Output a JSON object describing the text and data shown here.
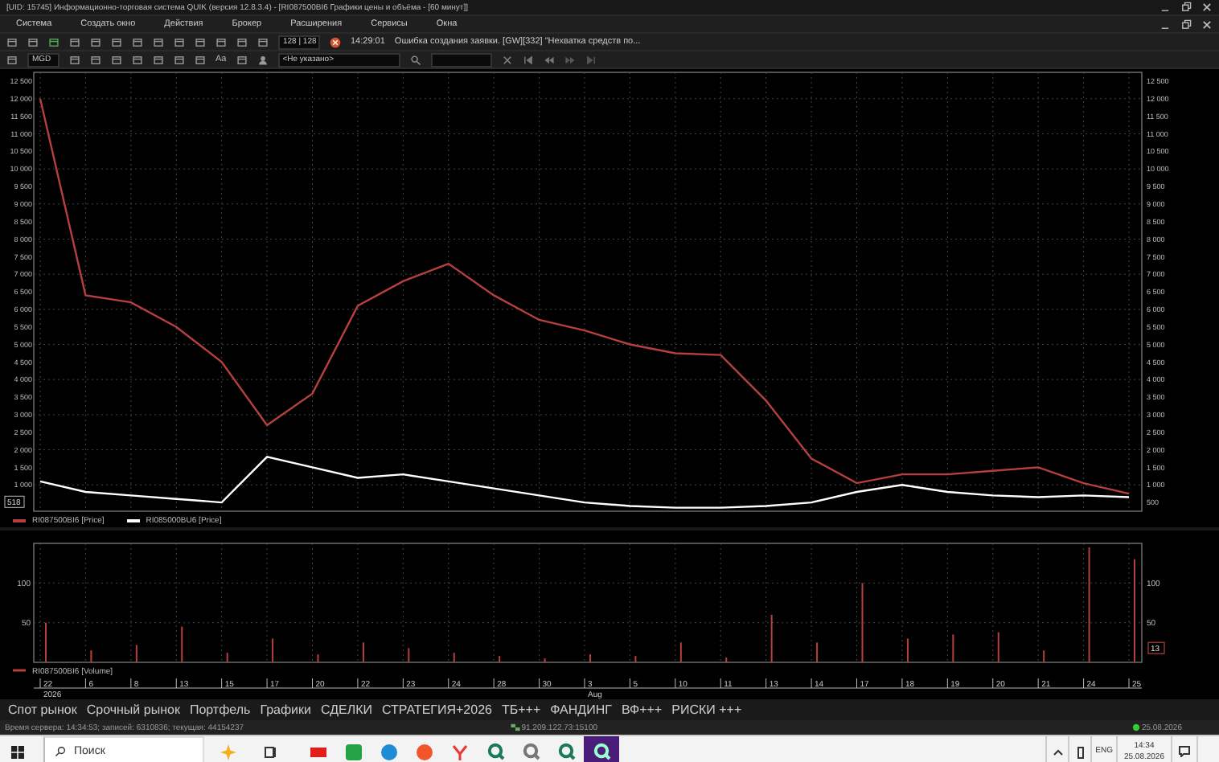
{
  "window": {
    "title": "[UID: 15745] Информационно-торговая система QUIK (версия 12.8.3.4) - [RI087500BI6 Графики цены и объёма - [60 минут]]"
  },
  "menu": [
    "Система",
    "Создать окно",
    "Действия",
    "Брокер",
    "Расширения",
    "Сервисы",
    "Окна"
  ],
  "toolbar": {
    "counter": "128 | 128",
    "message_time": "14:29:01",
    "message": "Ошибка создания заявки. [GW][332] \"Нехватка средств по...",
    "interval": "MGD",
    "font_button": "Aa",
    "account": "<Не указано>"
  },
  "price_chart": {
    "current_value": "518",
    "left_axis_labels": [
      "12 500",
      "12 000",
      "11 500",
      "11 000",
      "10 500",
      "10 000",
      "9 500",
      "9 000",
      "8 500",
      "8 000",
      "7 500",
      "7 000",
      "6 500",
      "6 000",
      "5 500",
      "5 000",
      "4 500",
      "4 000",
      "3 500",
      "3 000",
      "2 500",
      "2 000",
      "1 500",
      "1 000"
    ],
    "chart_data": {
      "type": "line",
      "grid": true,
      "ylim": [
        250,
        12750
      ],
      "yticks": [
        500,
        {
          "value": 1000,
          "label": "1 000"
        },
        {
          "value": 1500,
          "label": "1 500"
        },
        {
          "value": 2000,
          "label": "2 000"
        },
        {
          "value": 2500,
          "label": "2 500"
        },
        {
          "value": 3000,
          "label": "3 000"
        },
        {
          "value": 3500,
          "label": "3 500"
        },
        {
          "value": 4000,
          "label": "4 000"
        },
        {
          "value": 4500,
          "label": "4 500"
        },
        {
          "value": 5000,
          "label": "5 000"
        },
        {
          "value": 5500,
          "label": "5 500"
        },
        {
          "value": 6000,
          "label": "6 000"
        },
        {
          "value": 6500,
          "label": "6 500"
        },
        {
          "value": 7000,
          "label": "7 000"
        },
        {
          "value": 7500,
          "label": "7 500"
        },
        {
          "value": 8000,
          "label": "8 000"
        },
        {
          "value": 8500,
          "label": "8 500"
        },
        {
          "value": 9000,
          "label": "9 000"
        },
        {
          "value": 9500,
          "label": "9 500"
        },
        {
          "value": 10000,
          "label": "10 000"
        },
        {
          "value": 10500,
          "label": "10 500"
        },
        {
          "value": 11000,
          "label": "11 000"
        },
        {
          "value": 11500,
          "label": "11 500"
        },
        {
          "value": 12000,
          "label": "12 000"
        },
        {
          "value": 12500,
          "label": "12 500"
        }
      ],
      "series": [
        {
          "name": "RI087500BI6 [Price]",
          "color": "#b5403f",
          "values": [
            12000,
            6400,
            6200,
            5500,
            4500,
            2700,
            3600,
            6100,
            6800,
            7300,
            6400,
            5700,
            5400,
            5000,
            4750,
            4700,
            3400,
            1750,
            1050,
            1300,
            1300,
            1400,
            1500,
            1050,
            750
          ]
        },
        {
          "name": "RI085000BU6 [Price]",
          "color": "#ffffff",
          "values": [
            1100,
            800,
            700,
            600,
            500,
            1800,
            1500,
            1200,
            1300,
            1100,
            900,
            700,
            500,
            400,
            350,
            350,
            400,
            500,
            800,
            1000,
            800,
            700,
            650,
            700,
            650
          ]
        }
      ]
    }
  },
  "volume_chart": {
    "current_value": "13",
    "left_axis_labels": [
      "100",
      "50"
    ],
    "chart_data": {
      "type": "bar",
      "grid": true,
      "categories": [
        "22",
        "6",
        "8",
        "13",
        "15",
        "17",
        "20",
        "22",
        "23",
        "24",
        "28",
        "30",
        "3",
        "5",
        "10",
        "11",
        "13",
        "14",
        "17",
        "18",
        "19",
        "20",
        "21",
        "24",
        "25"
      ],
      "ylim": [
        0,
        150
      ],
      "yticks": [
        {
          "value": 50,
          "label": "50"
        },
        {
          "value": 100,
          "label": "100"
        }
      ],
      "series": [
        {
          "name": "RI087500BI6 [Volume]",
          "color": "#b5403f",
          "values": [
            50,
            15,
            22,
            45,
            12,
            30,
            10,
            25,
            18,
            12,
            8,
            5,
            10,
            8,
            25,
            6,
            60,
            25,
            100,
            30,
            35,
            38,
            15,
            145,
            130
          ]
        }
      ]
    }
  },
  "time_axis": {
    "year": "2026",
    "month": "Aug"
  },
  "tabs": [
    "Спот рынок",
    "Срочный рынок",
    "Портфель",
    "Графики",
    "СДЕЛКИ",
    "СТРАТЕГИЯ+2026",
    "ТБ+++",
    "ФАНДИНГ",
    "ВФ+++",
    "РИСКИ +++"
  ],
  "status_bar": {
    "server": "Время сервера: 14:34:53; записей: 6310836; текущая: 44154237",
    "address": "91.209.122.73:15100",
    "date": "25.08.2026"
  },
  "taskbar": {
    "search_placeholder": "Поиск",
    "language": "ENG",
    "time": "14:34",
    "date": "25.08.2026"
  }
}
